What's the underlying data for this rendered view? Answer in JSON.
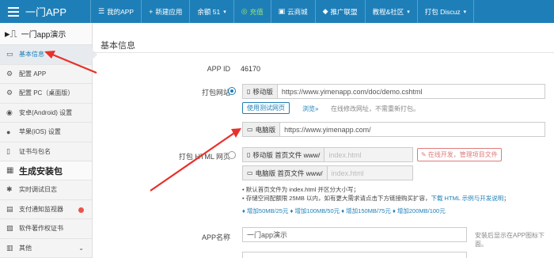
{
  "topbar": {
    "brand": "一门APP",
    "items": [
      {
        "label": "我的APP",
        "icon": "☰"
      },
      {
        "label": "新建应用",
        "icon": "+"
      },
      {
        "label": "余额 51",
        "icon": "",
        "caret": "▾"
      },
      {
        "label": "充值",
        "icon": "◎"
      },
      {
        "label": "云商城",
        "icon": "▣"
      },
      {
        "label": "推广联盟",
        "icon": "◆"
      },
      {
        "label": "教程&社区",
        "icon": "",
        "caret": "▾"
      },
      {
        "label": "打包 Discuz",
        "icon": "",
        "caret": "▾"
      }
    ]
  },
  "sidebar": {
    "app_name": "一门app演示",
    "items": [
      {
        "label": "基本信息",
        "icon": "▭"
      },
      {
        "label": "配置 APP",
        "icon": "⚙"
      },
      {
        "label": "配置 PC（桌面版）",
        "icon": "⚙"
      },
      {
        "label": "安卓(Android) 设置",
        "icon": "◉"
      },
      {
        "label": "苹果(iOS) 设置",
        "icon": "●"
      },
      {
        "label": "证书与包名",
        "icon": "▯"
      }
    ],
    "section": "生成安装包",
    "items2": [
      {
        "label": "实时调试日志",
        "icon": "✱"
      },
      {
        "label": "支付通知监视器",
        "icon": "▤"
      },
      {
        "label": "软件著作权证书",
        "icon": "▧"
      },
      {
        "label": "其他",
        "icon": "▥",
        "chev": "⌄"
      }
    ]
  },
  "main": {
    "title": "基本信息",
    "app_id_label": "APP ID",
    "app_id": "46170",
    "pack_site_label": "打包网站",
    "mobile_addon": "移动版",
    "mobile_url": "https://www.yimenapp.com/doc/demo.cshtml",
    "test_site_btn": "使用测试网页",
    "browse_link": "浏览»",
    "online_hint": "在线修改网址，不需重新打包。",
    "pc_addon": "电脑版",
    "pc_url": "https://www.yimenapp.com/",
    "pack_html_label": "打包 HTML 网页",
    "mobile_home_addon": "移动版 首页文件 www/",
    "pc_home_addon": "电脑版 首页文件 www/",
    "index_placeholder": "index.html",
    "online_dev_btn": "在线开发，管理项目文件",
    "note1": "• 默认首页文件为 index.html 并区分大小写；",
    "note2a": "• 存储空间配额限 25MB 以内，如有更大需求请点击下方链接购买扩容，",
    "note2b": "下载 HTML 示例与开发说明",
    "note2c": "；",
    "buy_links": [
      "♦ 增加50MB/25元",
      "♦ 增加100MB/50元",
      "♦ 增加150MB/75元",
      "♦ 增加200MB/100元"
    ],
    "app_name_label": "APP名称",
    "app_name_value": "一门app演示",
    "app_name_hint": "安装后显示在APP图标下面。"
  },
  "colors": {
    "primary": "#1e7fb8",
    "arrow": "#e8302a",
    "badge": "#e8554a"
  }
}
